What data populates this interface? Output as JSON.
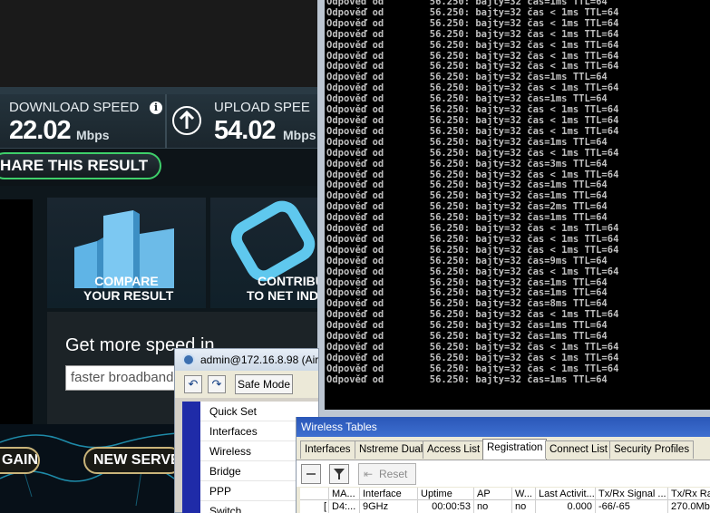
{
  "speedtest": {
    "download": {
      "label": "DOWNLOAD SPEED",
      "value": "22.02",
      "unit": "Mbps"
    },
    "upload": {
      "label": "UPLOAD SPEE",
      "value": "54.02",
      "unit": "Mbps"
    },
    "share_label": "HARE THIS RESULT",
    "compare": {
      "line1": "COMPARE",
      "line2": "YOUR RESULT"
    },
    "contribute": {
      "line1": "CONTRIBUT",
      "line2": "TO NET INDE"
    },
    "get_more": "Get more speed in",
    "broadband_input": "faster broadband",
    "again_label": "GAIN",
    "new_server_label": "NEW SERVE"
  },
  "console": {
    "lines": [
      "Odpověď od        56.250: bajty=32 čas=1ms TTL=64",
      "Odpověď od        56.250: bajty=32 čas < 1ms TTL=64",
      "Odpověď od        56.250: bajty=32 čas < 1ms TTL=64",
      "Odpověď od        56.250: bajty=32 čas < 1ms TTL=64",
      "Odpověď od        56.250: bajty=32 čas < 1ms TTL=64",
      "Odpověď od        56.250: bajty=32 čas < 1ms TTL=64",
      "Odpověď od        56.250: bajty=32 čas < 1ms TTL=64",
      "Odpověď od        56.250: bajty=32 čas=1ms TTL=64",
      "Odpověď od        56.250: bajty=32 čas < 1ms TTL=64",
      "Odpověď od        56.250: bajty=32 čas=1ms TTL=64",
      "Odpověď od        56.250: bajty=32 čas < 1ms TTL=64",
      "Odpověď od        56.250: bajty=32 čas < 1ms TTL=64",
      "Odpověď od        56.250: bajty=32 čas < 1ms TTL=64",
      "Odpověď od        56.250: bajty=32 čas=1ms TTL=64",
      "Odpověď od        56.250: bajty=32 čas < 1ms TTL=64",
      "Odpověď od        56.250: bajty=32 čas=3ms TTL=64",
      "Odpověď od        56.250: bajty=32 čas < 1ms TTL=64",
      "Odpověď od        56.250: bajty=32 čas=1ms TTL=64",
      "Odpověď od        56.250: bajty=32 čas=1ms TTL=64",
      "Odpověď od        56.250: bajty=32 čas=2ms TTL=64",
      "Odpověď od        56.250: bajty=32 čas=1ms TTL=64",
      "Odpověď od        56.250: bajty=32 čas < 1ms TTL=64",
      "Odpověď od        56.250: bajty=32 čas < 1ms TTL=64",
      "Odpověď od        56.250: bajty=32 čas < 1ms TTL=64",
      "Odpověď od        56.250: bajty=32 čas=9ms TTL=64",
      "Odpověď od        56.250: bajty=32 čas < 1ms TTL=64",
      "Odpověď od        56.250: bajty=32 čas=1ms TTL=64",
      "Odpověď od        56.250: bajty=32 čas=1ms TTL=64",
      "Odpověď od        56.250: bajty=32 čas=8ms TTL=64",
      "Odpověď od        56.250: bajty=32 čas < 1ms TTL=64",
      "Odpověď od        56.250: bajty=32 čas=1ms TTL=64",
      "Odpověď od        56.250: bajty=32 čas=1ms TTL=64",
      "Odpověď od        56.250: bajty=32 čas < 1ms TTL=64",
      "Odpověď od        56.250: bajty=32 čas < 1ms TTL=64",
      "Odpověď od        56.250: bajty=32 čas < 1ms TTL=64",
      "Odpověď od        56.250: bajty=32 čas=1ms TTL=64"
    ]
  },
  "winbox": {
    "title": "admin@172.16.8.98 (Air",
    "undo_glyph": "↶",
    "redo_glyph": "↷",
    "safe_mode": "Safe Mode",
    "menu": [
      "Quick Set",
      "Interfaces",
      "Wireless",
      "Bridge",
      "PPP",
      "Switch"
    ]
  },
  "wireless_tables": {
    "title": "Wireless Tables",
    "tabs": [
      "Interfaces",
      "Nstreme Dual",
      "Access List",
      "Registration",
      "Connect List",
      "Security Profiles"
    ],
    "active_tab": "Registration",
    "reset_label": "Reset",
    "columns": [
      "",
      "MA...",
      "Interface",
      "Uptime",
      "AP",
      "W...",
      "Last Activit...",
      "Tx/Rx Signal ...",
      "Tx/Rx Ra"
    ],
    "row": [
      "[",
      "D4:...",
      "9GHz",
      "00:00:53",
      "no",
      "no",
      "0.000",
      "-66/-65",
      "270.0Mbp"
    ]
  },
  "colors": {
    "console_bg": "#000000",
    "console_text": "#c0c0c0",
    "speed_green": "#3ecf6a",
    "winbox_title": "#2a57b8"
  }
}
